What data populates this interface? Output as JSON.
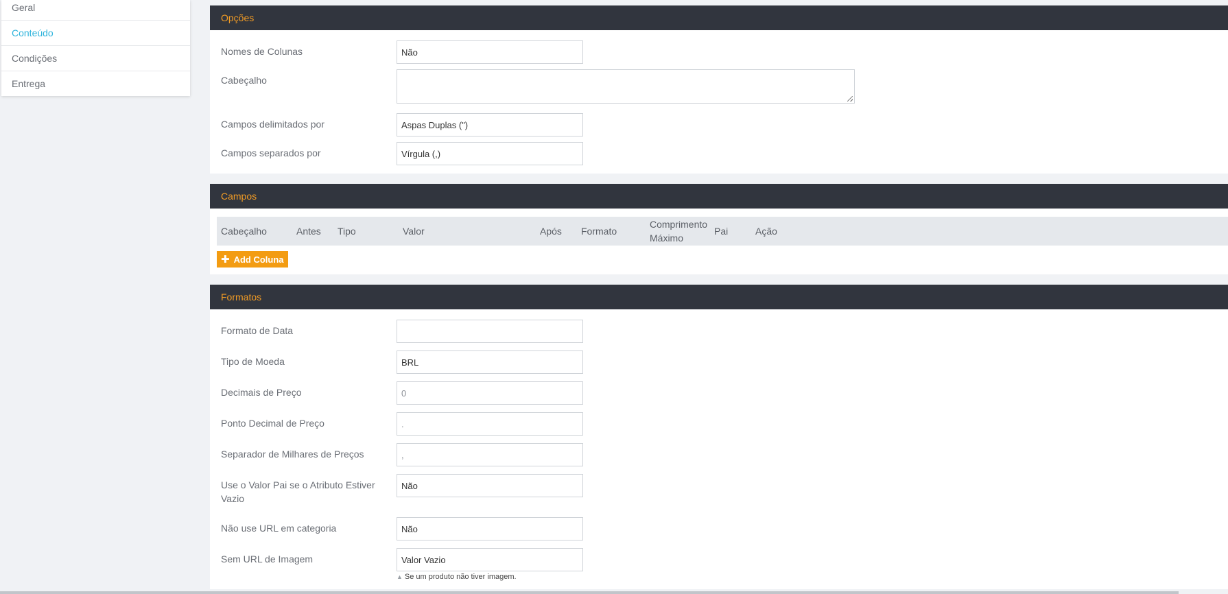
{
  "sidebar": {
    "items": [
      {
        "label": "Geral"
      },
      {
        "label": "Conteúdo"
      },
      {
        "label": "Condições"
      },
      {
        "label": "Entrega"
      }
    ]
  },
  "opcoes": {
    "title": "Opções",
    "fields": [
      {
        "label": "Nomes de Colunas",
        "value": "Não"
      },
      {
        "label": "Cabeçalho",
        "value": ""
      },
      {
        "label": "Campos delimitados por",
        "value": "Aspas Duplas (\")"
      },
      {
        "label": "Campos separados por",
        "value": "Vírgula (,)"
      }
    ]
  },
  "campos": {
    "title": "Campos",
    "columns": [
      "Cabeçalho",
      "Antes",
      "Tipo",
      "Valor",
      "Após",
      "Formato",
      "Comprimento Máximo",
      "Pai",
      "Ação"
    ],
    "add_button": "Add Coluna"
  },
  "formatos": {
    "title": "Formatos",
    "fields": [
      {
        "label": "Formato de Data",
        "value": ""
      },
      {
        "label": "Tipo de Moeda",
        "value": "BRL"
      },
      {
        "label": "Decimais de Preço",
        "value": "0"
      },
      {
        "label": "Ponto Decimal de Preço",
        "value": "."
      },
      {
        "label": "Separador de Milhares de Preços",
        "value": ","
      },
      {
        "label": "Use o Valor Pai se o Atributo Estiver Vazio",
        "value": "Não"
      },
      {
        "label": "Não use URL em categoria",
        "value": "Não"
      },
      {
        "label": "Sem URL de Imagem",
        "value": "Valor Vazio"
      }
    ],
    "hint": "Se um produto não tiver imagem."
  },
  "colors": {
    "header_bg": "#31353e",
    "header_text": "#f39c24",
    "active_link": "#2fb4dc",
    "button": "#f39c12"
  }
}
